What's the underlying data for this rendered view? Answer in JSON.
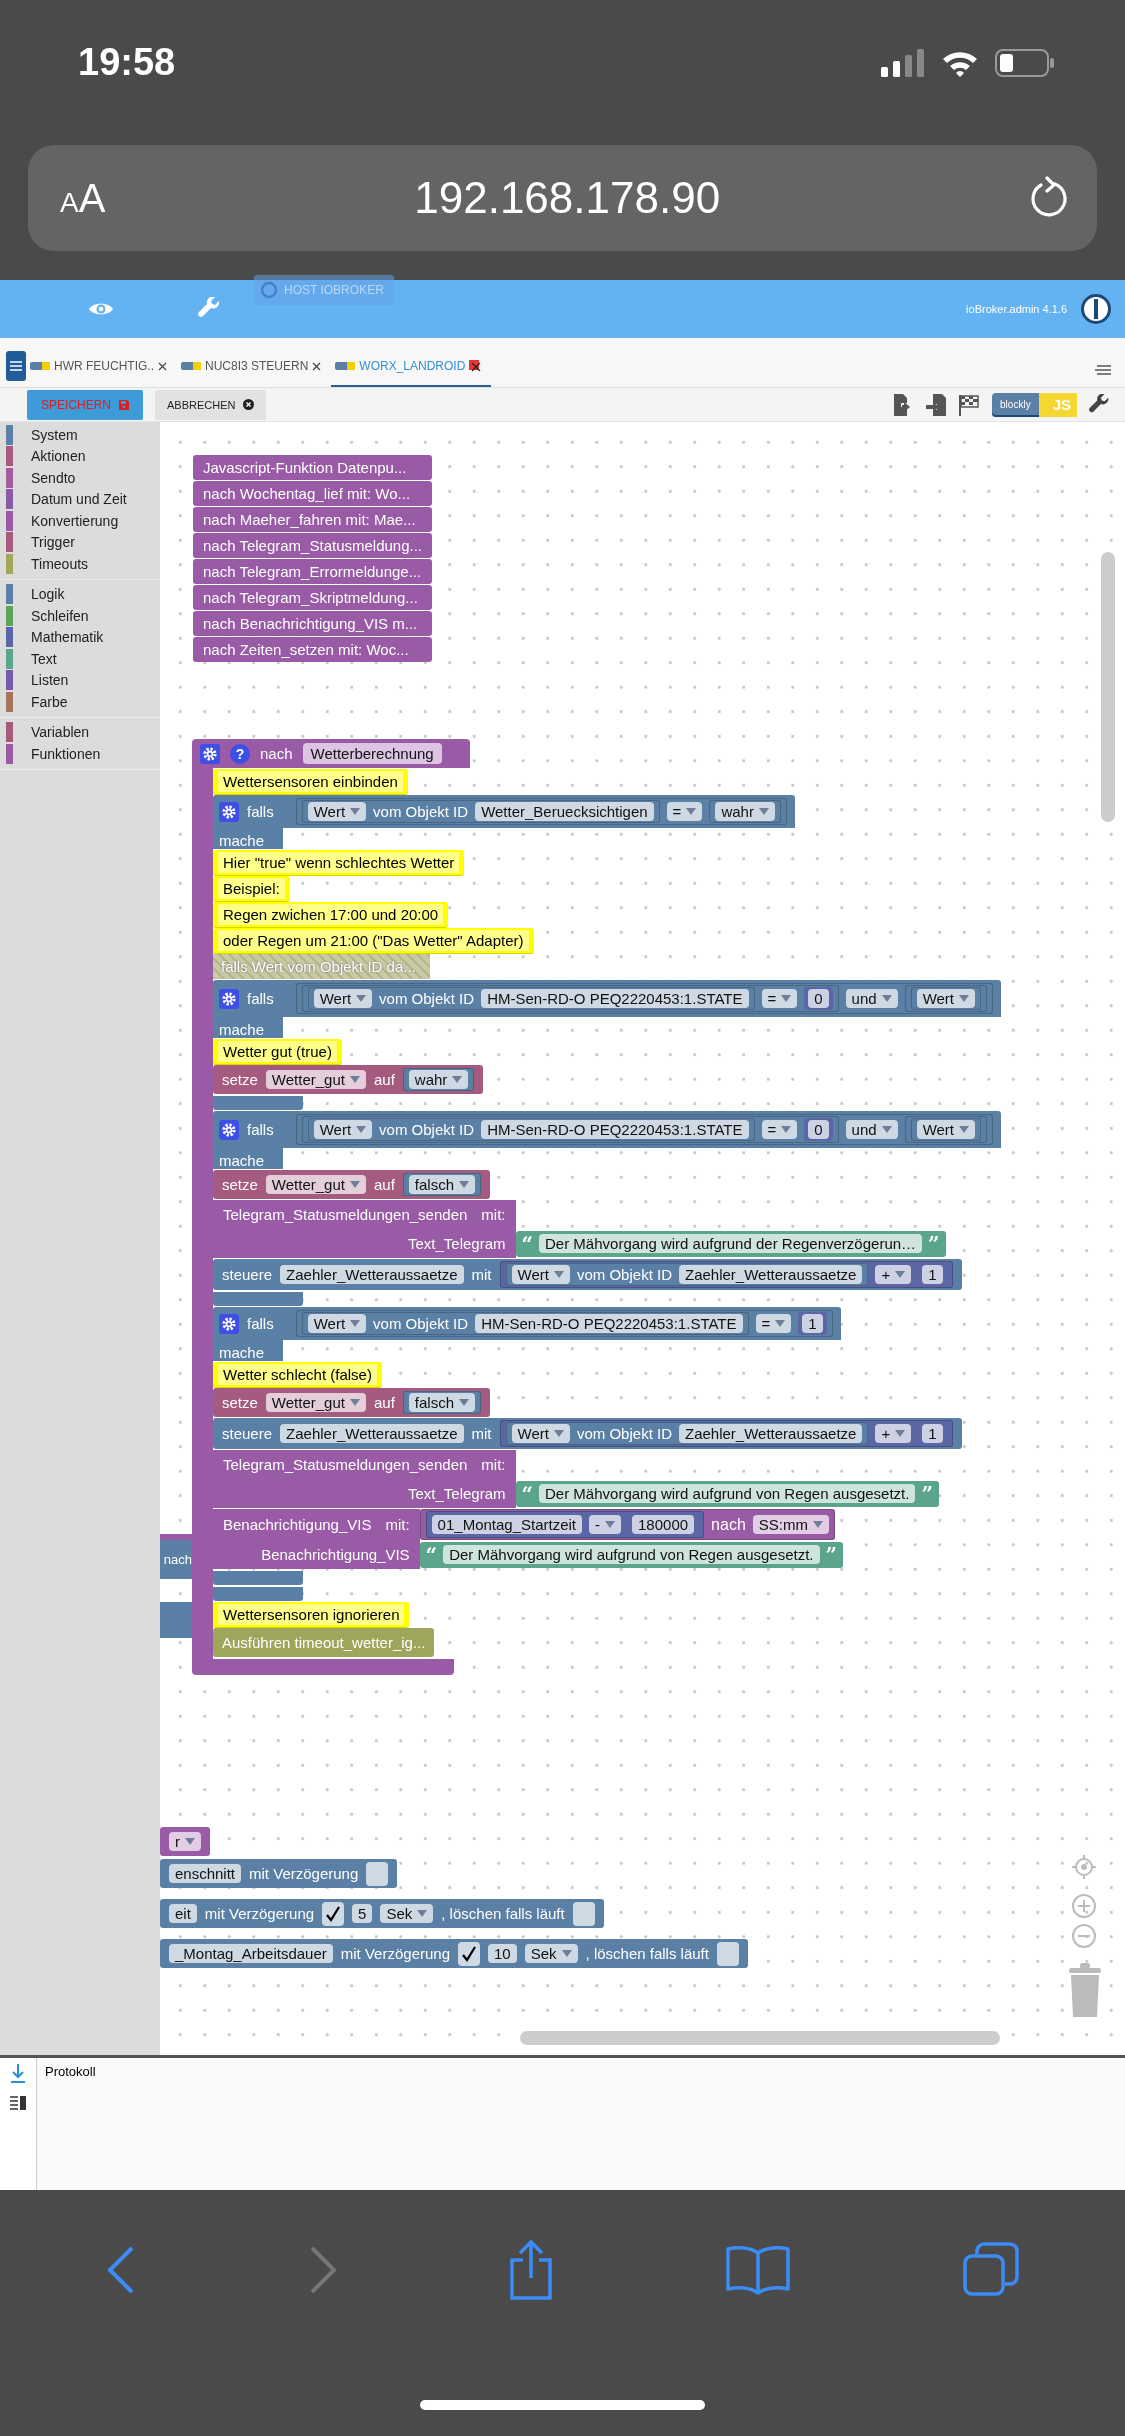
{
  "phone_status": {
    "time": "19:58"
  },
  "browser_bar": {
    "text_size_button": [
      "A",
      "A"
    ],
    "url": "192.168.178.90"
  },
  "app_header": {
    "host_button": "HOST IOBROKER",
    "version": "ioBroker.admin 4.1.6"
  },
  "tabs": [
    {
      "label": "HWR FEUCHTIG..",
      "selected": false
    },
    {
      "label": "NUC8I3 STEUERN",
      "selected": false
    },
    {
      "label": "WORX_LANDROID",
      "selected": true
    }
  ],
  "toolbar": {
    "save": "SPEICHERN",
    "cancel": "ABBRECHEN",
    "mode_switch": [
      {
        "label": "blockly",
        "selected": true
      },
      {
        "label": "JS",
        "selected": false
      }
    ]
  },
  "categories": [
    [
      {
        "label": "System",
        "color": "#5b80a5"
      },
      {
        "label": "Aktionen",
        "color": "#a55b80"
      },
      {
        "label": "Sendto",
        "color": "#a55ba0"
      },
      {
        "label": "Datum und Zeit",
        "color": "#8a5ba5"
      },
      {
        "label": "Konvertierung",
        "color": "#995ba5"
      },
      {
        "label": "Trigger",
        "color": "#a55b80"
      },
      {
        "label": "Timeouts",
        "color": "#a5a55b"
      }
    ],
    [
      {
        "label": "Logik",
        "color": "#5b80a5"
      },
      {
        "label": "Schleifen",
        "color": "#5ba55b"
      },
      {
        "label": "Mathematik",
        "color": "#5b67a5"
      },
      {
        "label": "Text",
        "color": "#5ba58c"
      },
      {
        "label": "Listen",
        "color": "#745ba5"
      },
      {
        "label": "Farbe",
        "color": "#a5745b"
      }
    ],
    [
      {
        "label": "Variablen",
        "color": "#a55b80"
      },
      {
        "label": "Funktionen",
        "color": "#995ba5"
      }
    ]
  ],
  "function_blocks": [
    "Javascript-Funktion Datenpu...",
    "nach Wochentag_lief mit: Wo...",
    "nach Maeher_fahren mit: Mae...",
    "nach Telegram_Statusmeldung...",
    "nach Telegram_Errormeldunge...",
    "nach Telegram_Skriptmeldung...",
    "nach Benachrichtigung_VIS m...",
    "nach Zeiten_setzen mit: Woc..."
  ],
  "main_block": {
    "help": "?",
    "label": "nach",
    "name": "Wetterberechnung",
    "body": [
      {
        "kind": "comment",
        "text": "Wettersensoren einbinden"
      },
      {
        "kind": "if",
        "label": "falls",
        "do_label": "mache",
        "cond": [
          {
            "kind": "logic_block",
            "tokens": [
              {
                "kind": "logic_block",
                "tokens": [
                  {
                    "kind": "dropdown",
                    "text": "Wert"
                  },
                  {
                    "kind": "text",
                    "text": "vom Objekt ID"
                  },
                  {
                    "kind": "field",
                    "text": "Wetter_Beruecksichtigen"
                  }
                ]
              },
              {
                "kind": "dropdown",
                "text": "="
              },
              {
                "kind": "logic_block",
                "tokens": [
                  {
                    "kind": "dropdown",
                    "text": "wahr"
                  }
                ]
              }
            ]
          }
        ],
        "body": [
          {
            "kind": "comment",
            "text": "Hier \"true\" wenn schlechtes Wetter"
          },
          {
            "kind": "comment",
            "text": "Beispiel:"
          },
          {
            "kind": "comment",
            "text": "Regen zwichen 17:00 und 20:00"
          },
          {
            "kind": "comment",
            "text": "oder Regen um 21:00 (\"Das Wetter\" Adapter)"
          },
          {
            "kind": "disabled",
            "text": "falls Wert vom Objekt ID da..."
          },
          {
            "kind": "if",
            "label": "falls",
            "do_label": "mache",
            "cond": [
              {
                "kind": "logic_block",
                "tokens": [
                  {
                    "kind": "logic_block",
                    "tokens": [
                      {
                        "kind": "logic_block",
                        "tokens": [
                          {
                            "kind": "dropdown",
                            "text": "Wert"
                          },
                          {
                            "kind": "text",
                            "text": "vom Objekt ID"
                          },
                          {
                            "kind": "field",
                            "text": "HM-Sen-RD-O PEQ2220453:1.STATE"
                          }
                        ]
                      },
                      {
                        "kind": "dropdown",
                        "text": "="
                      },
                      {
                        "kind": "number",
                        "text": "0"
                      }
                    ]
                  },
                  {
                    "kind": "dropdown",
                    "text": "und"
                  },
                  {
                    "kind": "logic_block",
                    "tokens": [
                      {
                        "kind": "logic_block",
                        "tokens": [
                          {
                            "kind": "dropdown",
                            "text": "Wert"
                          }
                        ]
                      }
                    ]
                  }
                ]
              }
            ],
            "body": [
              {
                "kind": "comment",
                "text": "Wetter gut (true)"
              },
              {
                "kind": "set",
                "tokens": [
                  {
                    "kind": "text",
                    "text": "setze"
                  },
                  {
                    "kind": "dropdown",
                    "text": "Wetter_gut"
                  },
                  {
                    "kind": "text",
                    "text": "auf"
                  },
                  {
                    "kind": "logic_block",
                    "tokens": [
                      {
                        "kind": "dropdown",
                        "text": "wahr"
                      }
                    ]
                  }
                ]
              }
            ]
          },
          {
            "kind": "if",
            "label": "falls",
            "do_label": "mache",
            "cond": [
              {
                "kind": "logic_block",
                "tokens": [
                  {
                    "kind": "logic_block",
                    "tokens": [
                      {
                        "kind": "logic_block",
                        "tokens": [
                          {
                            "kind": "dropdown",
                            "text": "Wert"
                          },
                          {
                            "kind": "text",
                            "text": "vom Objekt ID"
                          },
                          {
                            "kind": "field",
                            "text": "HM-Sen-RD-O PEQ2220453:1.STATE"
                          }
                        ]
                      },
                      {
                        "kind": "dropdown",
                        "text": "="
                      },
                      {
                        "kind": "number",
                        "text": "0"
                      }
                    ]
                  },
                  {
                    "kind": "dropdown",
                    "text": "und"
                  },
                  {
                    "kind": "logic_block",
                    "tokens": [
                      {
                        "kind": "logic_block",
                        "tokens": [
                          {
                            "kind": "dropdown",
                            "text": "Wert"
                          }
                        ]
                      }
                    ]
                  }
                ]
              }
            ],
            "body": [
              {
                "kind": "set",
                "tokens": [
                  {
                    "kind": "text",
                    "text": "setze"
                  },
                  {
                    "kind": "dropdown",
                    "text": "Wetter_gut"
                  },
                  {
                    "kind": "text",
                    "text": "auf"
                  },
                  {
                    "kind": "logic_block",
                    "tokens": [
                      {
                        "kind": "dropdown",
                        "text": "falsch"
                      }
                    ]
                  }
                ]
              },
              {
                "kind": "call",
                "tokens": [
                  {
                    "kind": "text",
                    "text": "Telegram_Statusmeldungen_senden"
                  },
                  {
                    "kind": "text",
                    "text": "mit:"
                  }
                ],
                "args": [
                  {
                    "name": "Text_Telegram",
                    "value": {
                      "kind": "string",
                      "open": "“",
                      "text": "Der Mähvorgang wird aufgrund der Regenverzögerun…",
                      "close": "”"
                    }
                  }
                ]
              },
              {
                "kind": "control",
                "tokens": [
                  {
                    "kind": "text",
                    "text": "steuere"
                  },
                  {
                    "kind": "field",
                    "text": "Zaehler_Wetteraussaetze"
                  },
                  {
                    "kind": "text",
                    "text": "mit"
                  },
                  {
                    "kind": "math_block",
                    "tokens": [
                      {
                        "kind": "logic_block",
                        "tokens": [
                          {
                            "kind": "dropdown",
                            "text": "Wert"
                          },
                          {
                            "kind": "text",
                            "text": "vom Objekt ID"
                          },
                          {
                            "kind": "field",
                            "text": "Zaehler_Wetteraussaetze"
                          }
                        ]
                      },
                      {
                        "kind": "dropdown",
                        "text": "+"
                      },
                      {
                        "kind": "number",
                        "text": "1"
                      }
                    ]
                  }
                ]
              }
            ]
          },
          {
            "kind": "if",
            "label": "falls",
            "do_label": "mache",
            "cond": [
              {
                "kind": "logic_block",
                "tokens": [
                  {
                    "kind": "logic_block",
                    "tokens": [
                      {
                        "kind": "dropdown",
                        "text": "Wert"
                      },
                      {
                        "kind": "text",
                        "text": "vom Objekt ID"
                      },
                      {
                        "kind": "field",
                        "text": "HM-Sen-RD-O PEQ2220453:1.STATE"
                      }
                    ]
                  },
                  {
                    "kind": "dropdown",
                    "text": "="
                  },
                  {
                    "kind": "number",
                    "text": "1"
                  }
                ]
              }
            ],
            "body": [
              {
                "kind": "comment",
                "text": "Wetter schlecht (false)"
              },
              {
                "kind": "set",
                "tokens": [
                  {
                    "kind": "text",
                    "text": "setze"
                  },
                  {
                    "kind": "dropdown",
                    "text": "Wetter_gut"
                  },
                  {
                    "kind": "text",
                    "text": "auf"
                  },
                  {
                    "kind": "logic_block",
                    "tokens": [
                      {
                        "kind": "dropdown",
                        "text": "falsch"
                      }
                    ]
                  }
                ]
              },
              {
                "kind": "control",
                "tokens": [
                  {
                    "kind": "text",
                    "text": "steuere"
                  },
                  {
                    "kind": "field",
                    "text": "Zaehler_Wetteraussaetze"
                  },
                  {
                    "kind": "text",
                    "text": "mit"
                  },
                  {
                    "kind": "math_block",
                    "tokens": [
                      {
                        "kind": "logic_block",
                        "tokens": [
                          {
                            "kind": "dropdown",
                            "text": "Wert"
                          },
                          {
                            "kind": "text",
                            "text": "vom Objekt ID"
                          },
                          {
                            "kind": "field",
                            "text": "Zaehler_Wetteraussaetze"
                          }
                        ]
                      },
                      {
                        "kind": "dropdown",
                        "text": "+"
                      },
                      {
                        "kind": "number",
                        "text": "1"
                      }
                    ]
                  }
                ]
              },
              {
                "kind": "call",
                "tokens": [
                  {
                    "kind": "text",
                    "text": "Telegram_Statusmeldungen_senden"
                  },
                  {
                    "kind": "text",
                    "text": "mit:"
                  }
                ],
                "args": [
                  {
                    "name": "Text_Telegram",
                    "value": {
                      "kind": "string",
                      "open": "“",
                      "text": "Der Mähvorgang wird aufgrund von Regen ausgesetzt.",
                      "close": "”"
                    }
                  }
                ]
              },
              {
                "kind": "call",
                "tokens": [
                  {
                    "kind": "text",
                    "text": "Benachrichtigung_VIS"
                  },
                  {
                    "kind": "text",
                    "text": "mit:"
                  }
                ],
                "overlapping_block": {
                  "kind": "time_block",
                  "tokens": [
                    {
                      "kind": "math_block",
                      "tokens": [
                        {
                          "kind": "field",
                          "text": "01_Montag_Startzeit"
                        },
                        {
                          "kind": "dropdown",
                          "text": "-"
                        },
                        {
                          "kind": "number",
                          "text": "180000"
                        }
                      ]
                    },
                    {
                      "kind": "text",
                      "text": "nach"
                    },
                    {
                      "kind": "dropdown",
                      "text": "SS:mm"
                    }
                  ]
                },
                "args": [
                  {
                    "name": "Benachrichtigung_VIS",
                    "value": {
                      "kind": "string",
                      "open": "“",
                      "text": "Der Mähvorgang wird aufgrund von Regen ausgesetzt.",
                      "close": "”"
                    }
                  }
                ]
              }
            ]
          }
        ]
      },
      {
        "kind": "comment",
        "text": "Wettersensoren ignorieren"
      },
      {
        "kind": "timeout",
        "text": "Ausführen timeout_wetter_ig..."
      }
    ]
  },
  "side_block": {
    "text": "nach"
  },
  "bottom_blocks": [
    {
      "kind": "variable",
      "tokens": [
        {
          "kind": "dropdown",
          "text": "r"
        }
      ]
    },
    {
      "kind": "action",
      "tokens": [
        {
          "kind": "field",
          "text": "enschnitt"
        },
        {
          "kind": "text",
          "text": "mit Verzögerung"
        },
        {
          "kind": "checkbox",
          "checked": false
        }
      ]
    },
    {
      "kind": "action",
      "tokens": [
        {
          "kind": "field",
          "text": "eit"
        },
        {
          "kind": "text",
          "text": "mit Verzögerung"
        },
        {
          "kind": "checkbox",
          "checked": true
        },
        {
          "kind": "field",
          "text": "5"
        },
        {
          "kind": "dropdown",
          "text": "Sek"
        },
        {
          "kind": "text",
          "text": ", löschen falls läuft"
        },
        {
          "kind": "checkbox",
          "checked": false
        }
      ]
    },
    {
      "kind": "action",
      "tokens": [
        {
          "kind": "field",
          "text": "_Montag_Arbeitsdauer"
        },
        {
          "kind": "text",
          "text": "mit Verzögerung"
        },
        {
          "kind": "checkbox",
          "checked": true
        },
        {
          "kind": "field",
          "text": "10"
        },
        {
          "kind": "dropdown",
          "text": "Sek"
        },
        {
          "kind": "text",
          "text": ", löschen falls läuft"
        },
        {
          "kind": "checkbox",
          "checked": false
        }
      ]
    }
  ],
  "log_panel": {
    "title": "Protokoll"
  },
  "browser_toolbar": {
    "back": {
      "disabled": false
    },
    "forward": {
      "disabled": true
    }
  }
}
